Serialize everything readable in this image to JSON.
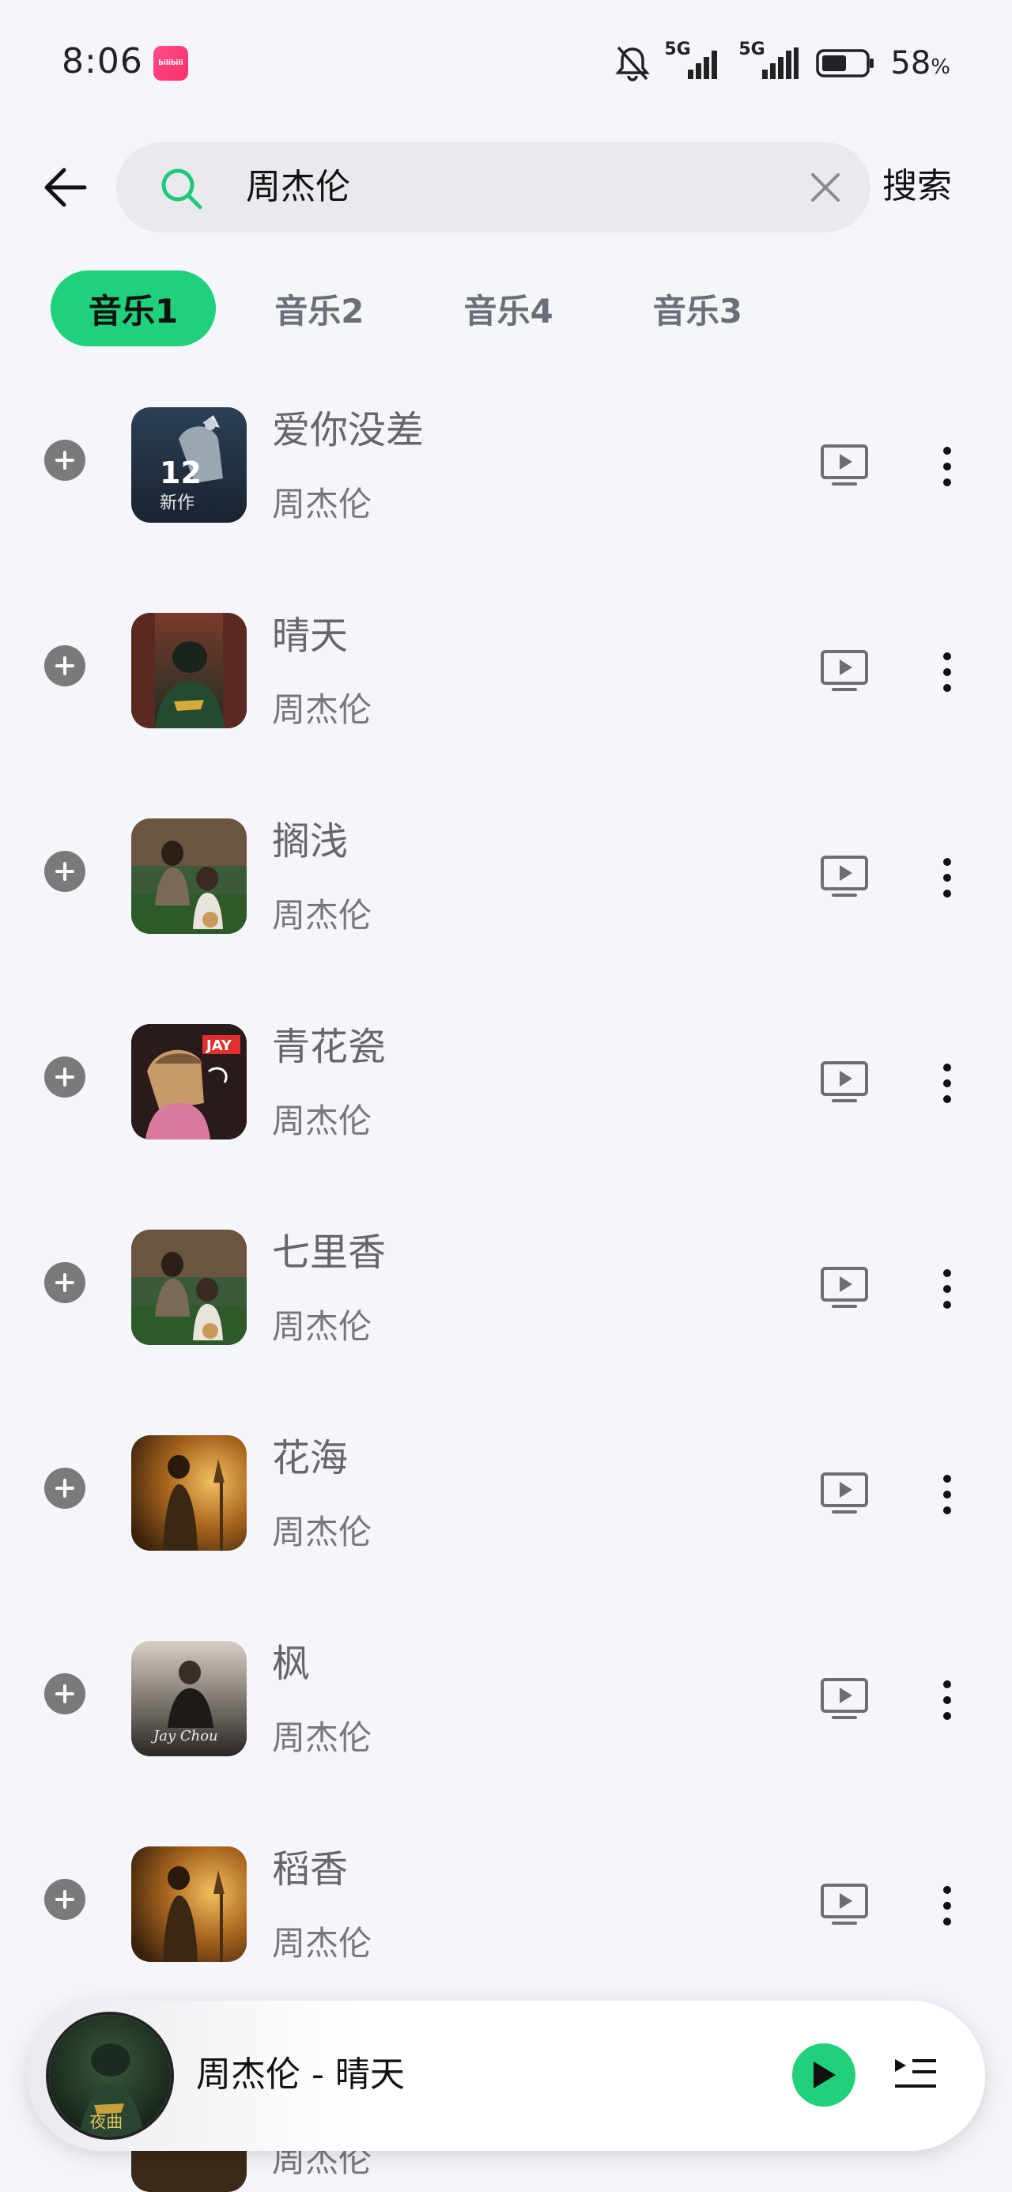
{
  "status_bar": {
    "time": "8:06",
    "app_badge": "bilibili",
    "network_1": "5G",
    "network_2": "5G",
    "battery_percent": "58",
    "battery_unit": "%",
    "battery_level": 0.58
  },
  "search": {
    "query": "周杰伦",
    "submit_label": "搜索"
  },
  "tabs": [
    {
      "label": "音乐1",
      "active": true
    },
    {
      "label": "音乐2",
      "active": false
    },
    {
      "label": "音乐4",
      "active": false
    },
    {
      "label": "音乐3",
      "active": false
    }
  ],
  "songs": [
    {
      "title": "爱你没差",
      "artist": "周杰伦",
      "cover": "album-12"
    },
    {
      "title": "晴天",
      "artist": "周杰伦",
      "cover": "album-yehuimei"
    },
    {
      "title": "搁浅",
      "artist": "周杰伦",
      "cover": "album-qilixiang"
    },
    {
      "title": "青花瓷",
      "artist": "周杰伦",
      "cover": "album-jay-pink"
    },
    {
      "title": "七里香",
      "artist": "周杰伦",
      "cover": "album-qilixiang"
    },
    {
      "title": "花海",
      "artist": "周杰伦",
      "cover": "album-mojiezuo"
    },
    {
      "title": "枫",
      "artist": "周杰伦",
      "cover": "album-november"
    },
    {
      "title": "稻香",
      "artist": "周杰伦",
      "cover": "album-mojiezuo"
    }
  ],
  "peek_row": {
    "artist": "周杰伦"
  },
  "player": {
    "now_playing": "周杰伦 - 晴天",
    "accent": "#20d07a"
  },
  "colors": {
    "accent": "#20d07a",
    "background": "#f4f6fc",
    "search_bg": "#e8eaed"
  }
}
